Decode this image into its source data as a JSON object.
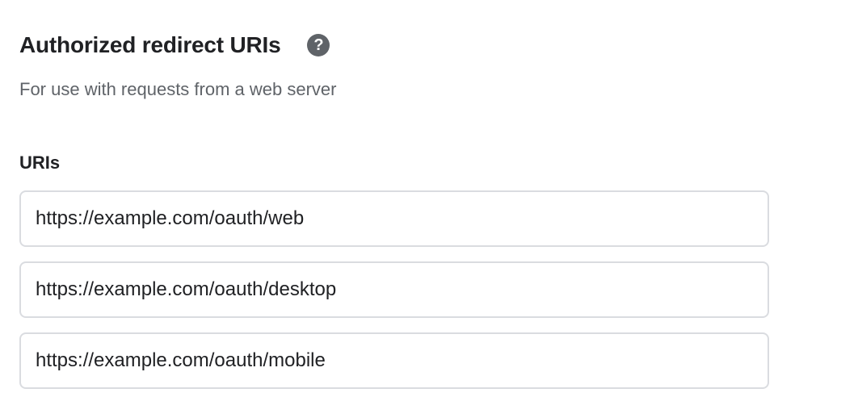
{
  "section": {
    "title": "Authorized redirect URIs",
    "help_icon": "help-circle-icon",
    "help_glyph": "?",
    "subtitle": "For use with requests from a web server"
  },
  "uris": {
    "label": "URIs",
    "items": [
      {
        "value": "https://example.com/oauth/web"
      },
      {
        "value": "https://example.com/oauth/desktop"
      },
      {
        "value": "https://example.com/oauth/mobile"
      }
    ]
  },
  "colors": {
    "heading": "#202124",
    "secondary_text": "#5f6368",
    "icon_bg": "#5f6368",
    "field_border": "#dadce0"
  }
}
